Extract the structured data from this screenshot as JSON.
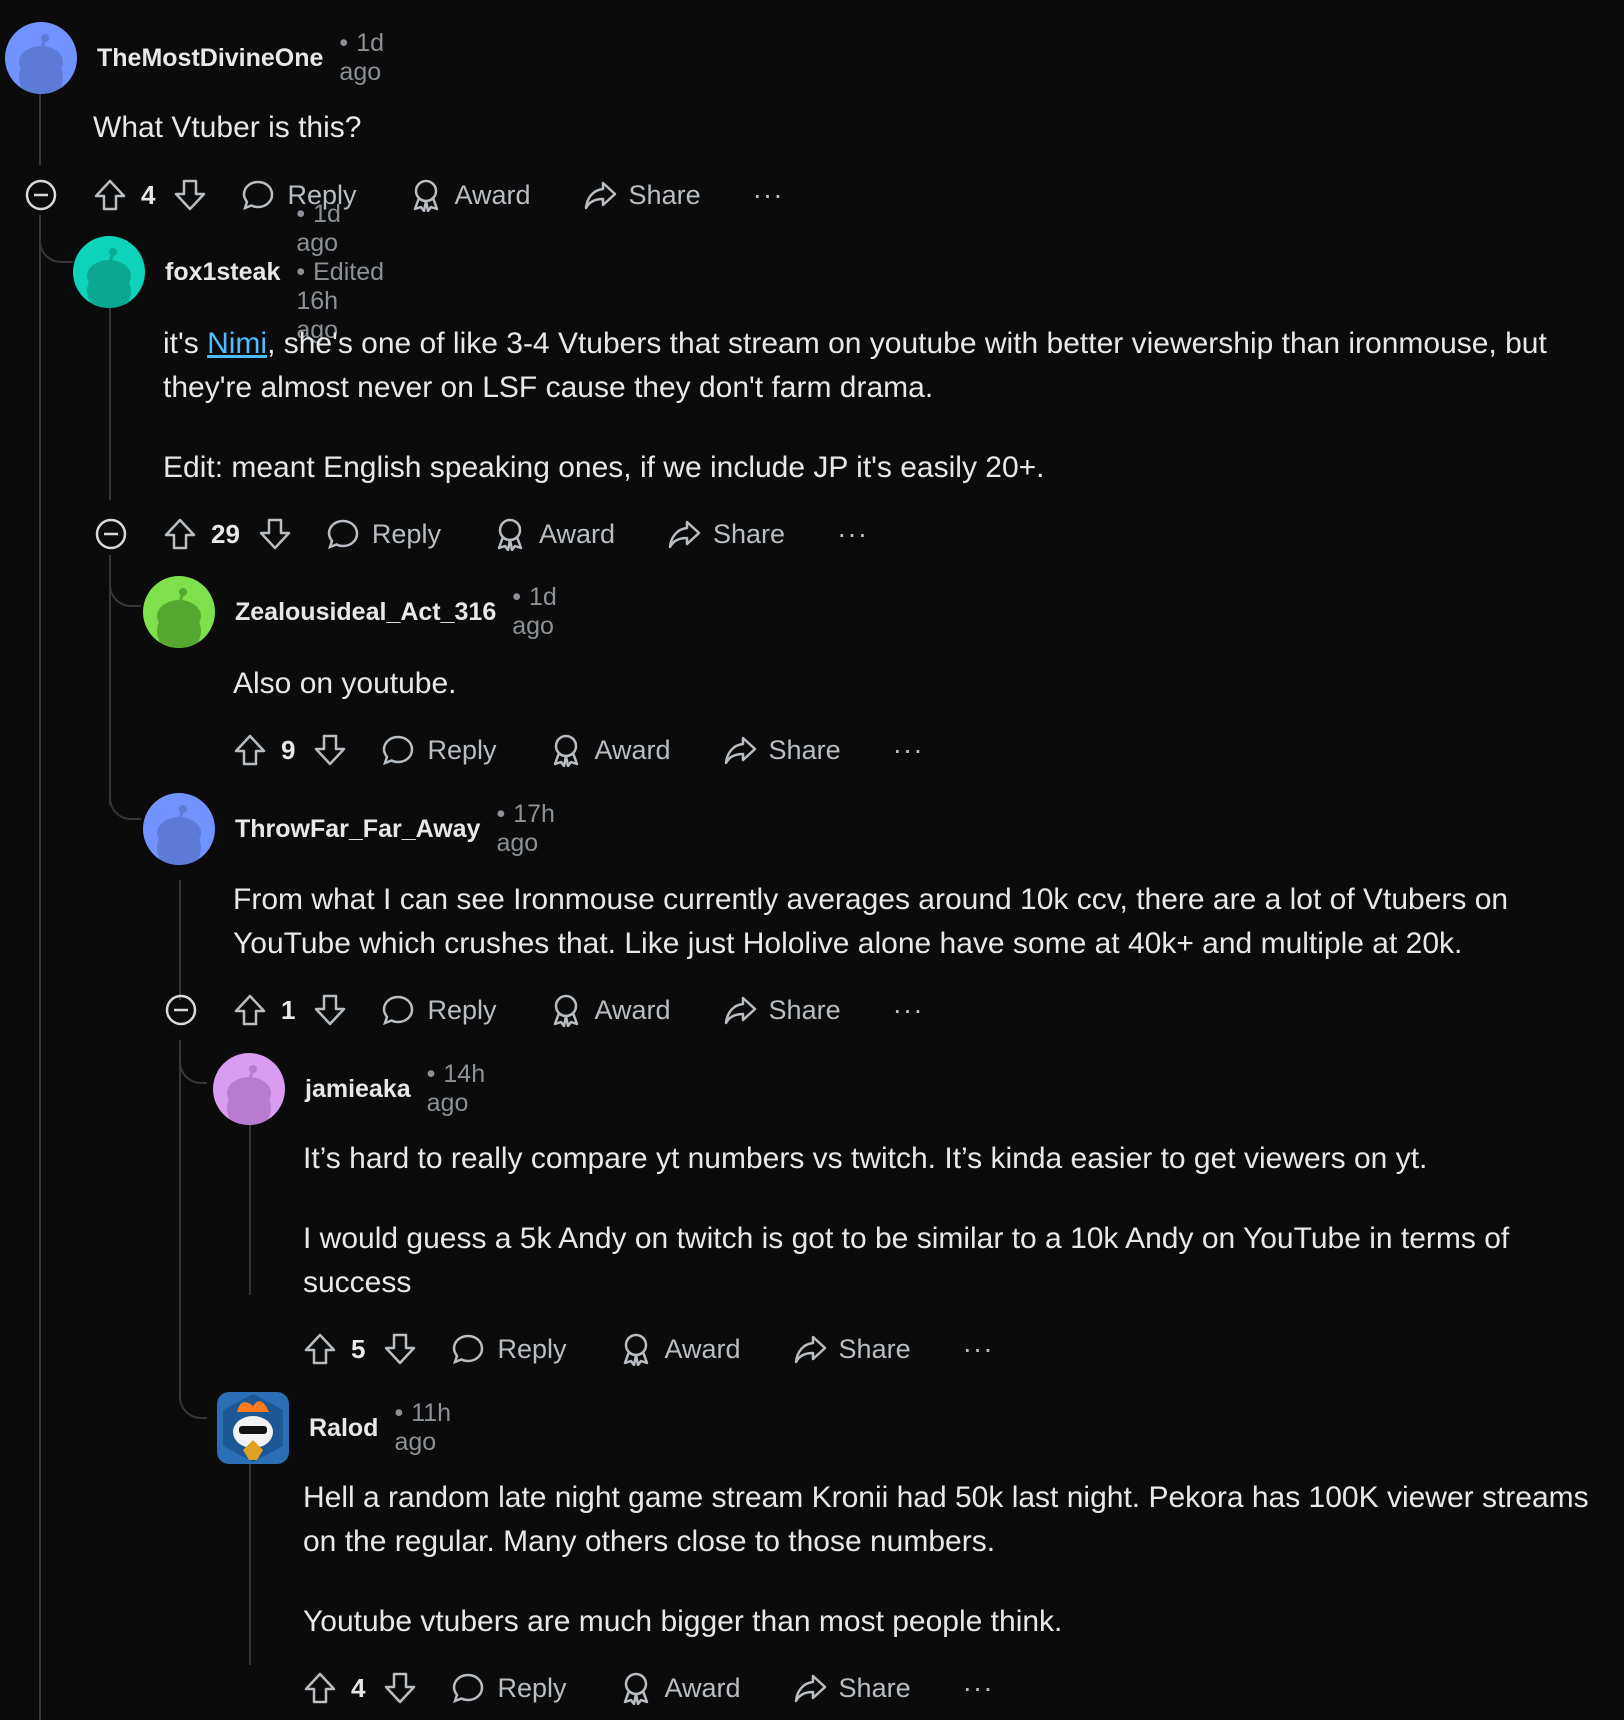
{
  "actions": {
    "reply": "Reply",
    "award": "Award",
    "share": "Share",
    "more": "···"
  },
  "comments": [
    {
      "user": "TheMostDivineOne",
      "time": "1d ago",
      "edited": "",
      "score": "4",
      "body": [
        "What Vtuber is this?"
      ],
      "avatar_color": "#7193ff"
    },
    {
      "user": "fox1steak",
      "time": "1d ago",
      "edited": "Edited 16h ago",
      "score": "29",
      "body_link": "Nimi",
      "body_pre": "it's ",
      "body_post": ", she's one of like 3-4 Vtubers that stream on youtube with better viewership than ironmouse, but they're almost never on LSF cause they don't farm drama.",
      "body2": "Edit: meant English speaking ones, if we include JP it's easily 20+.",
      "avatar_color": "#0dd3bb"
    },
    {
      "user": "Zealousideal_Act_316",
      "time": "1d ago",
      "edited": "",
      "score": "9",
      "body": [
        "Also on youtube."
      ],
      "avatar_color": "#7ee04b"
    },
    {
      "user": "ThrowFar_Far_Away",
      "time": "17h ago",
      "edited": "",
      "score": "1",
      "body": [
        "From what I can see Ironmouse currently averages around 10k ccv, there are a lot of Vtubers on YouTube which crushes that. Like just Hololive alone have some at 40k+ and multiple at 20k."
      ],
      "avatar_color": "#7193ff"
    },
    {
      "user": "jamieaka",
      "time": "14h ago",
      "edited": "",
      "score": "5",
      "body": [
        "It’s hard to really compare yt numbers vs twitch. It’s kinda easier to get viewers on yt.",
        "I would guess a 5k Andy on twitch is got to be similar to a 10k Andy on YouTube in terms of success"
      ],
      "avatar_color": "#d99cf0"
    },
    {
      "user": "Ralod",
      "time": "11h ago",
      "edited": "",
      "score": "4",
      "body": [
        "Hell a random late night game stream Kronii had 50k last night. Pekora has 100K viewer streams on the regular. Many others close to those numbers.",
        "Youtube vtubers are much bigger than most people think."
      ],
      "avatar_color": "#2b6fb6"
    }
  ]
}
